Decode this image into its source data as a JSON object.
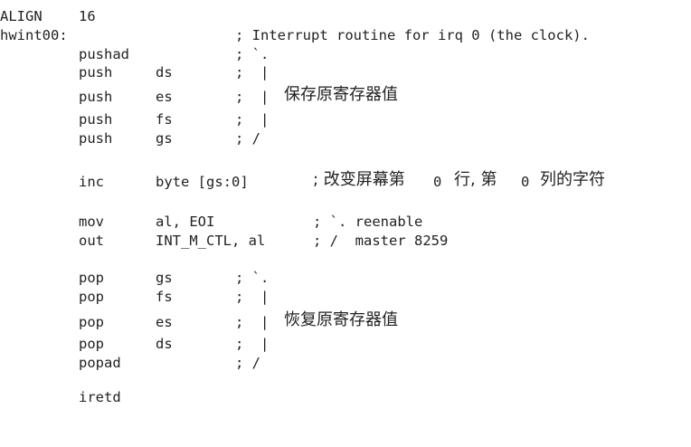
{
  "lines": [
    {
      "label": "ALIGN",
      "operand": "16"
    },
    {
      "label": "hwint00:",
      "comment": "; Interrupt routine for irq 0 (the clock)."
    },
    {
      "mnemonic": "pushad",
      "comment": "; `."
    },
    {
      "mnemonic": "push",
      "operand": "ds",
      "comment": ";  |"
    },
    {
      "mnemonic": "push",
      "operand": "es",
      "comment": ";  |",
      "note": "保存原寄存器值"
    },
    {
      "mnemonic": "push",
      "operand": "fs",
      "comment": ";  |"
    },
    {
      "mnemonic": "push",
      "operand": "gs",
      "comment": "; /"
    },
    {
      "mnemonic": "inc",
      "operand": "byte [gs:0]",
      "comment_a": "; 改变屏幕第",
      "num_a": "0",
      "comment_b": "行, 第",
      "num_b": "0",
      "comment_c": "列的字符"
    },
    {
      "mnemonic": "mov",
      "operand": "al, EOI",
      "comment": "; `. reenable"
    },
    {
      "mnemonic": "out",
      "operand": "INT_M_CTL, al",
      "comment": "; /  master 8259"
    },
    {
      "mnemonic": "pop",
      "operand": "gs",
      "comment": "; `."
    },
    {
      "mnemonic": "pop",
      "operand": "fs",
      "comment": ";  |"
    },
    {
      "mnemonic": "pop",
      "operand": "es",
      "comment": ";  |",
      "note": "恢复原寄存器值"
    },
    {
      "mnemonic": "pop",
      "operand": "ds",
      "comment": ";  |"
    },
    {
      "mnemonic": "popad",
      "comment": "; /"
    },
    {
      "mnemonic": "iretd"
    }
  ]
}
